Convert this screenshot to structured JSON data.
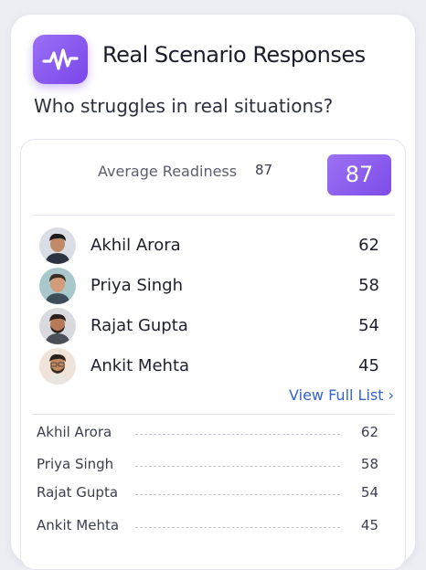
{
  "header": {
    "title": "Real Scenario Responses",
    "subtitle": "Who struggles in real situations?",
    "icon": "activity-wave-icon",
    "accent_color": "#8a5cf0"
  },
  "summary": {
    "label": "Average Readiness",
    "value": "87",
    "badge": "87",
    "icon": "sound-wave-icon"
  },
  "top_list": [
    {
      "name": "Akhil Arora",
      "score": "62"
    },
    {
      "name": "Priya Singh",
      "score": "58"
    },
    {
      "name": "Rajat Gupta",
      "score": "54"
    },
    {
      "name": "Ankit Mehta",
      "score": "45"
    }
  ],
  "view_full_list": "View Full List ›",
  "full_list": [
    {
      "name": "Akhil Arora",
      "score": "62"
    },
    {
      "name": "Priya Singh",
      "score": "58"
    },
    {
      "name": "Rajat Gupta",
      "score": "54"
    },
    {
      "name": "Ankit Mehta",
      "score": "45"
    }
  ],
  "colors": {
    "link": "#3164d0",
    "text": "#1d1f2c"
  }
}
